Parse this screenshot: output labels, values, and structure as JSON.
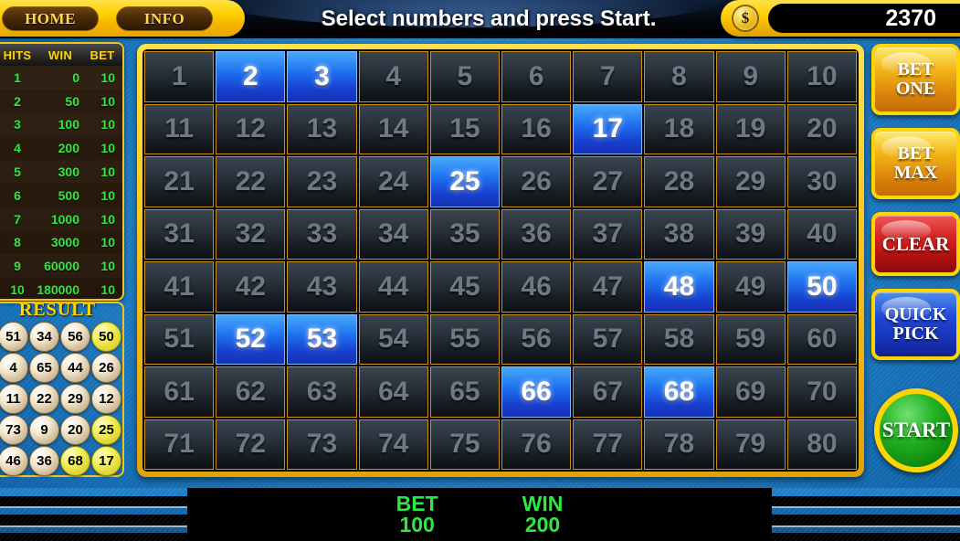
{
  "header": {
    "nav": {
      "home_label": "HOME",
      "info_label": "INFO"
    },
    "title": "Select numbers and press Start.",
    "coin_icon": "dollar-coin-icon",
    "coin_symbol": "$",
    "balance": "2370"
  },
  "paytable": {
    "columns": [
      "HITS",
      "WIN",
      "BET"
    ],
    "rows": [
      {
        "hits": "1",
        "win": "0",
        "bet": "10"
      },
      {
        "hits": "2",
        "win": "50",
        "bet": "10"
      },
      {
        "hits": "3",
        "win": "100",
        "bet": "10"
      },
      {
        "hits": "4",
        "win": "200",
        "bet": "10"
      },
      {
        "hits": "5",
        "win": "300",
        "bet": "10"
      },
      {
        "hits": "6",
        "win": "500",
        "bet": "10"
      },
      {
        "hits": "7",
        "win": "1000",
        "bet": "10"
      },
      {
        "hits": "8",
        "win": "3000",
        "bet": "10"
      },
      {
        "hits": "9",
        "win": "60000",
        "bet": "10"
      },
      {
        "hits": "10",
        "win": "180000",
        "bet": "10"
      }
    ]
  },
  "result": {
    "title": "RESULT",
    "balls": [
      {
        "n": "51",
        "hit": false
      },
      {
        "n": "34",
        "hit": false
      },
      {
        "n": "56",
        "hit": false
      },
      {
        "n": "50",
        "hit": true
      },
      {
        "n": "4",
        "hit": false
      },
      {
        "n": "65",
        "hit": false
      },
      {
        "n": "44",
        "hit": false
      },
      {
        "n": "26",
        "hit": false
      },
      {
        "n": "11",
        "hit": false
      },
      {
        "n": "22",
        "hit": false
      },
      {
        "n": "29",
        "hit": false
      },
      {
        "n": "12",
        "hit": false
      },
      {
        "n": "73",
        "hit": false
      },
      {
        "n": "9",
        "hit": false
      },
      {
        "n": "20",
        "hit": false
      },
      {
        "n": "25",
        "hit": true
      },
      {
        "n": "46",
        "hit": false
      },
      {
        "n": "36",
        "hit": false
      },
      {
        "n": "68",
        "hit": true
      },
      {
        "n": "17",
        "hit": true
      }
    ]
  },
  "grid": {
    "rows": 8,
    "cols": 10,
    "min": 1,
    "max": 80,
    "selected": [
      2,
      3,
      17,
      25,
      48,
      50,
      52,
      53,
      66,
      68
    ]
  },
  "buttons": {
    "bet_one": [
      "BET",
      "ONE"
    ],
    "bet_max": [
      "BET",
      "MAX"
    ],
    "clear": "CLEAR",
    "quick_pick": [
      "QUICK",
      "PICK"
    ],
    "start": "START"
  },
  "meters": {
    "bet_label": "BET",
    "bet_value": "100",
    "win_label": "WIN",
    "win_value": "200"
  },
  "colors": {
    "gold": "#ffd400",
    "selected_blue": "#1f72ef",
    "green_text": "#2ee83f",
    "red": "#d42222",
    "start_green": "#23b023",
    "background_blue": "#1f7fc6"
  }
}
